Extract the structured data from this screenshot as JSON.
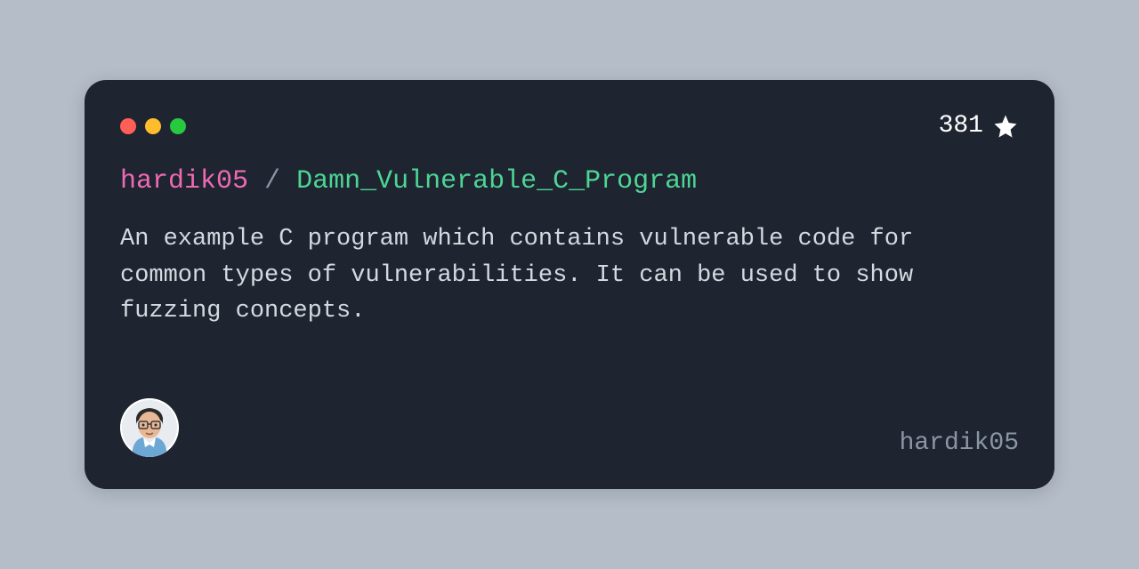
{
  "card": {
    "stars_count": "381",
    "owner": "hardik05",
    "separator": "/",
    "repo": "Damn_Vulnerable_C_Program",
    "description": "An example C program which contains vulnerable code for common types of vulnerabilities. It can be used to show fuzzing concepts.",
    "username": "hardik05"
  }
}
